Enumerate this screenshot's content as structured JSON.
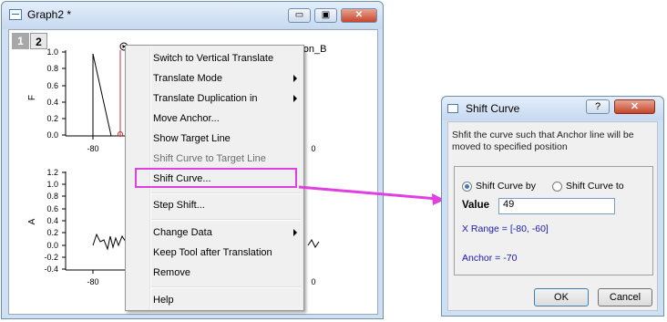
{
  "graph_window": {
    "title": "Graph2 *",
    "minimize_label": "▭",
    "restore_label": "▣",
    "close_label": "✕",
    "layer_tabs": [
      "1",
      "2"
    ],
    "top_plot": {
      "ylabel": "F",
      "legend_label": "Population_B",
      "yticks": [
        "1.0",
        "0.8",
        "0.6",
        "0.4",
        "0.2",
        "0.0"
      ],
      "xticks": [
        "-80",
        "0"
      ]
    },
    "bottom_plot": {
      "ylabel": "A",
      "yticks": [
        "1.2",
        "1.0",
        "0.8",
        "0.6",
        "0.4",
        "0.2",
        "0.0",
        "-0.2",
        "-0.4"
      ],
      "xticks": [
        "-80",
        "0"
      ]
    }
  },
  "context_menu": {
    "items": [
      {
        "label": "Switch to Vertical Translate",
        "submenu": false,
        "disabled": false
      },
      {
        "label": "Translate Mode",
        "submenu": true,
        "disabled": false
      },
      {
        "label": "Translate Duplication in",
        "submenu": true,
        "disabled": false
      },
      {
        "label": "Move Anchor...",
        "submenu": false,
        "disabled": false
      },
      {
        "label": "Show Target Line",
        "submenu": false,
        "disabled": false
      },
      {
        "label": "Shift Curve to Target Line",
        "submenu": false,
        "disabled": true
      },
      {
        "label": "Shift Curve...",
        "submenu": false,
        "disabled": false
      },
      {
        "label": "Step Shift...",
        "submenu": false,
        "disabled": false
      },
      {
        "label": "Change Data",
        "submenu": true,
        "disabled": false
      },
      {
        "label": "Keep Tool after Translation",
        "submenu": false,
        "disabled": false
      },
      {
        "label": "Remove",
        "submenu": false,
        "disabled": false
      },
      {
        "label": "Help",
        "submenu": false,
        "disabled": false
      }
    ],
    "highlight_color": "#e040e0"
  },
  "dialog": {
    "title": "Shift Curve",
    "help_label": "?",
    "close_label": "✕",
    "description": "Shfit the curve such that Anchor line will be moved to specified position",
    "option_shift_by": "Shift Curve by",
    "option_shift_to": "Shift Curve to",
    "selected_option": "Shift Curve by",
    "value_label": "Value",
    "value": "49",
    "x_range": "X Range = [-80, -60]",
    "anchor": "Anchor = -70",
    "ok_label": "OK",
    "cancel_label": "Cancel"
  },
  "colors": {
    "arrow": "#e040e0",
    "info_text": "#1a1aaa",
    "anchor_line": "#c03030"
  }
}
